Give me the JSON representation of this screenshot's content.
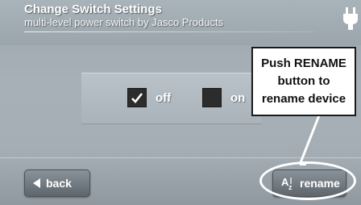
{
  "header": {
    "title": "Change Switch Settings",
    "subtitle": "multi-level power switch by Jasco Products",
    "icon": "plug-icon"
  },
  "options": [
    {
      "label": "off",
      "checked": true
    },
    {
      "label": "on",
      "checked": false
    }
  ],
  "footer": {
    "back_label": "back",
    "rename_label": "rename",
    "rename_icon": "a-to-z-sort-icon"
  },
  "callout": {
    "lines": [
      "Push RENAME",
      "button to",
      "rename device"
    ]
  }
}
